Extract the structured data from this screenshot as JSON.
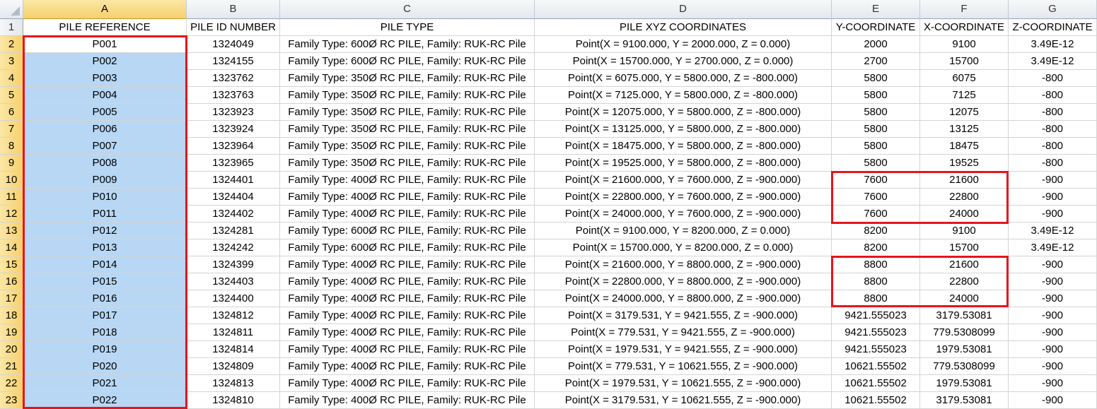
{
  "columns": [
    "A",
    "B",
    "C",
    "D",
    "E",
    "F",
    "G"
  ],
  "header_row_number": "1",
  "headers": [
    "PILE REFERENCE",
    "PILE ID NUMBER",
    "PILE TYPE",
    "PILE XYZ COORDINATES",
    "Y-COORDINATE",
    "X-COORDINATE",
    "Z-COORDINATE"
  ],
  "rows": [
    {
      "n": "2",
      "cells": [
        "P001",
        "1324049",
        "Family Type: 600Ø RC PILE, Family: RUK-RC Pile",
        "Point(X = 9100.000, Y = 2000.000, Z = 0.000)",
        "2000",
        "9100",
        "3.49E-12"
      ]
    },
    {
      "n": "3",
      "cells": [
        "P002",
        "1324155",
        "Family Type: 600Ø RC PILE, Family: RUK-RC Pile",
        "Point(X = 15700.000, Y = 2700.000, Z = 0.000)",
        "2700",
        "15700",
        "3.49E-12"
      ]
    },
    {
      "n": "4",
      "cells": [
        "P003",
        "1323762",
        "Family Type: 350Ø RC PILE, Family: RUK-RC Pile",
        "Point(X = 6075.000, Y = 5800.000, Z = -800.000)",
        "5800",
        "6075",
        "-800"
      ]
    },
    {
      "n": "5",
      "cells": [
        "P004",
        "1323763",
        "Family Type: 350Ø RC PILE, Family: RUK-RC Pile",
        "Point(X = 7125.000, Y = 5800.000, Z = -800.000)",
        "5800",
        "7125",
        "-800"
      ]
    },
    {
      "n": "6",
      "cells": [
        "P005",
        "1323923",
        "Family Type: 350Ø RC PILE, Family: RUK-RC Pile",
        "Point(X = 12075.000, Y = 5800.000, Z = -800.000)",
        "5800",
        "12075",
        "-800"
      ]
    },
    {
      "n": "7",
      "cells": [
        "P006",
        "1323924",
        "Family Type: 350Ø RC PILE, Family: RUK-RC Pile",
        "Point(X = 13125.000, Y = 5800.000, Z = -800.000)",
        "5800",
        "13125",
        "-800"
      ]
    },
    {
      "n": "8",
      "cells": [
        "P007",
        "1323964",
        "Family Type: 350Ø RC PILE, Family: RUK-RC Pile",
        "Point(X = 18475.000, Y = 5800.000, Z = -800.000)",
        "5800",
        "18475",
        "-800"
      ]
    },
    {
      "n": "9",
      "cells": [
        "P008",
        "1323965",
        "Family Type: 350Ø RC PILE, Family: RUK-RC Pile",
        "Point(X = 19525.000, Y = 5800.000, Z = -800.000)",
        "5800",
        "19525",
        "-800"
      ]
    },
    {
      "n": "10",
      "cells": [
        "P009",
        "1324401",
        "Family Type: 400Ø RC PILE, Family: RUK-RC Pile",
        "Point(X = 21600.000, Y = 7600.000, Z = -900.000)",
        "7600",
        "21600",
        "-900"
      ]
    },
    {
      "n": "11",
      "cells": [
        "P010",
        "1324404",
        "Family Type: 400Ø RC PILE, Family: RUK-RC Pile",
        "Point(X = 22800.000, Y = 7600.000, Z = -900.000)",
        "7600",
        "22800",
        "-900"
      ]
    },
    {
      "n": "12",
      "cells": [
        "P011",
        "1324402",
        "Family Type: 400Ø RC PILE, Family: RUK-RC Pile",
        "Point(X = 24000.000, Y = 7600.000, Z = -900.000)",
        "7600",
        "24000",
        "-900"
      ]
    },
    {
      "n": "13",
      "cells": [
        "P012",
        "1324281",
        "Family Type: 600Ø RC PILE, Family: RUK-RC Pile",
        "Point(X = 9100.000, Y = 8200.000, Z = 0.000)",
        "8200",
        "9100",
        "3.49E-12"
      ]
    },
    {
      "n": "14",
      "cells": [
        "P013",
        "1324242",
        "Family Type: 600Ø RC PILE, Family: RUK-RC Pile",
        "Point(X = 15700.000, Y = 8200.000, Z = 0.000)",
        "8200",
        "15700",
        "3.49E-12"
      ]
    },
    {
      "n": "15",
      "cells": [
        "P014",
        "1324399",
        "Family Type: 400Ø RC PILE, Family: RUK-RC Pile",
        "Point(X = 21600.000, Y = 8800.000, Z = -900.000)",
        "8800",
        "21600",
        "-900"
      ]
    },
    {
      "n": "16",
      "cells": [
        "P015",
        "1324403",
        "Family Type: 400Ø RC PILE, Family: RUK-RC Pile",
        "Point(X = 22800.000, Y = 8800.000, Z = -900.000)",
        "8800",
        "22800",
        "-900"
      ]
    },
    {
      "n": "17",
      "cells": [
        "P016",
        "1324400",
        "Family Type: 400Ø RC PILE, Family: RUK-RC Pile",
        "Point(X = 24000.000, Y = 8800.000, Z = -900.000)",
        "8800",
        "24000",
        "-900"
      ]
    },
    {
      "n": "18",
      "cells": [
        "P017",
        "1324812",
        "Family Type: 400Ø RC PILE, Family: RUK-RC Pile",
        "Point(X = 3179.531, Y = 9421.555, Z = -900.000)",
        "9421.555023",
        "3179.53081",
        "-900"
      ]
    },
    {
      "n": "19",
      "cells": [
        "P018",
        "1324811",
        "Family Type: 400Ø RC PILE, Family: RUK-RC Pile",
        "Point(X = 779.531, Y = 9421.555, Z = -900.000)",
        "9421.555023",
        "779.5308099",
        "-900"
      ]
    },
    {
      "n": "20",
      "cells": [
        "P019",
        "1324814",
        "Family Type: 400Ø RC PILE, Family: RUK-RC Pile",
        "Point(X = 1979.531, Y = 9421.555, Z = -900.000)",
        "9421.555023",
        "1979.53081",
        "-900"
      ]
    },
    {
      "n": "21",
      "cells": [
        "P020",
        "1324809",
        "Family Type: 400Ø RC PILE, Family: RUK-RC Pile",
        "Point(X = 779.531, Y = 10621.555, Z = -900.000)",
        "10621.55502",
        "779.5308099",
        "-900"
      ]
    },
    {
      "n": "22",
      "cells": [
        "P021",
        "1324813",
        "Family Type: 400Ø RC PILE, Family: RUK-RC Pile",
        "Point(X = 1979.531, Y = 10621.555, Z = -900.000)",
        "10621.55502",
        "1979.53081",
        "-900"
      ]
    },
    {
      "n": "23",
      "cells": [
        "P022",
        "1324810",
        "Family Type: 400Ø RC PILE, Family: RUK-RC Pile",
        "Point(X = 3179.531, Y = 10621.555, Z = -900.000)",
        "10621.55502",
        "3179.53081",
        "-900"
      ]
    }
  ],
  "selection": {
    "column": "A",
    "fill_color": "#b7d7f5",
    "header_highlight_color": "#f6d06b"
  },
  "annotation_color": "#e8141b"
}
